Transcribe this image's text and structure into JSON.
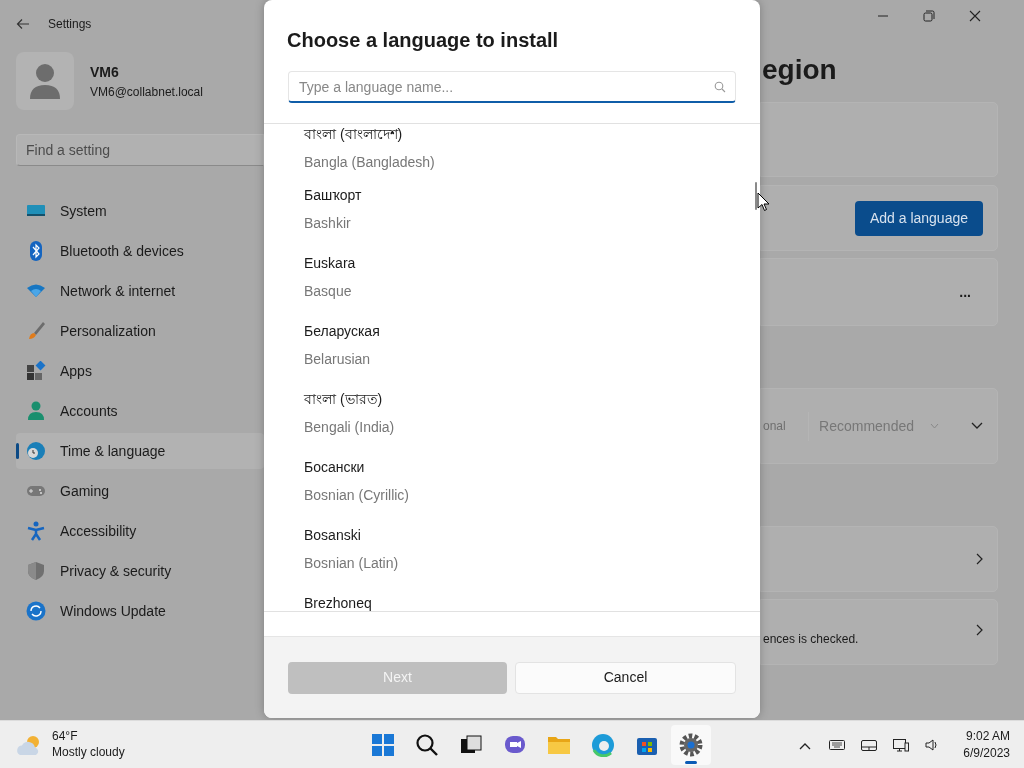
{
  "window": {
    "title": "Settings"
  },
  "account": {
    "name": "VM6",
    "email": "VM6@collabnet.local"
  },
  "search": {
    "placeholder": "Find a setting"
  },
  "nav": [
    {
      "label": "System",
      "selected": false
    },
    {
      "label": "Bluetooth & devices",
      "selected": false
    },
    {
      "label": "Network & internet",
      "selected": false
    },
    {
      "label": "Personalization",
      "selected": false
    },
    {
      "label": "Apps",
      "selected": false
    },
    {
      "label": "Accounts",
      "selected": false
    },
    {
      "label": "Time & language",
      "selected": true
    },
    {
      "label": "Gaming",
      "selected": false
    },
    {
      "label": "Accessibility",
      "selected": false
    },
    {
      "label": "Privacy & security",
      "selected": false
    },
    {
      "label": "Windows Update",
      "selected": false
    }
  ],
  "page": {
    "title": "egion",
    "cards": [
      {
        "kind": "blank"
      },
      {
        "kind": "button",
        "label": "Add a language"
      },
      {
        "kind": "more",
        "label": "..."
      },
      {
        "kind": "dropdown",
        "hint": "onal",
        "value": "Recommended"
      },
      {
        "kind": "link"
      },
      {
        "kind": "link",
        "text": "ences is checked."
      }
    ]
  },
  "dialog": {
    "title": "Choose a language to install",
    "search": {
      "placeholder": "Type a language name..."
    },
    "languages": [
      {
        "native": "বাংলা (বাংলাদেশ)",
        "english": "Bangla (Bangladesh)"
      },
      {
        "native": "Башҡорт",
        "english": "Bashkir"
      },
      {
        "native": "Euskara",
        "english": "Basque"
      },
      {
        "native": "Беларуская",
        "english": "Belarusian"
      },
      {
        "native": "বাংলা (ভারত)",
        "english": "Bengali (India)"
      },
      {
        "native": "Босански",
        "english": "Bosnian (Cyrillic)"
      },
      {
        "native": "Bosanski",
        "english": "Bosnian (Latin)"
      },
      {
        "native": "Brezhoneq"
      }
    ],
    "buttons": [
      {
        "label": "Next",
        "disabled": true
      },
      {
        "label": "Cancel",
        "disabled": false
      }
    ]
  },
  "taskbar": {
    "weather": {
      "temp": "64°F",
      "text": "Mostly cloudy"
    },
    "apps": [
      {
        "selected": false
      },
      {
        "selected": false
      },
      {
        "selected": false
      },
      {
        "selected": false
      },
      {
        "selected": false
      },
      {
        "selected": false
      },
      {
        "selected": false
      },
      {
        "selected": true
      }
    ],
    "time": "9:02 AM",
    "date": "6/9/2023"
  }
}
